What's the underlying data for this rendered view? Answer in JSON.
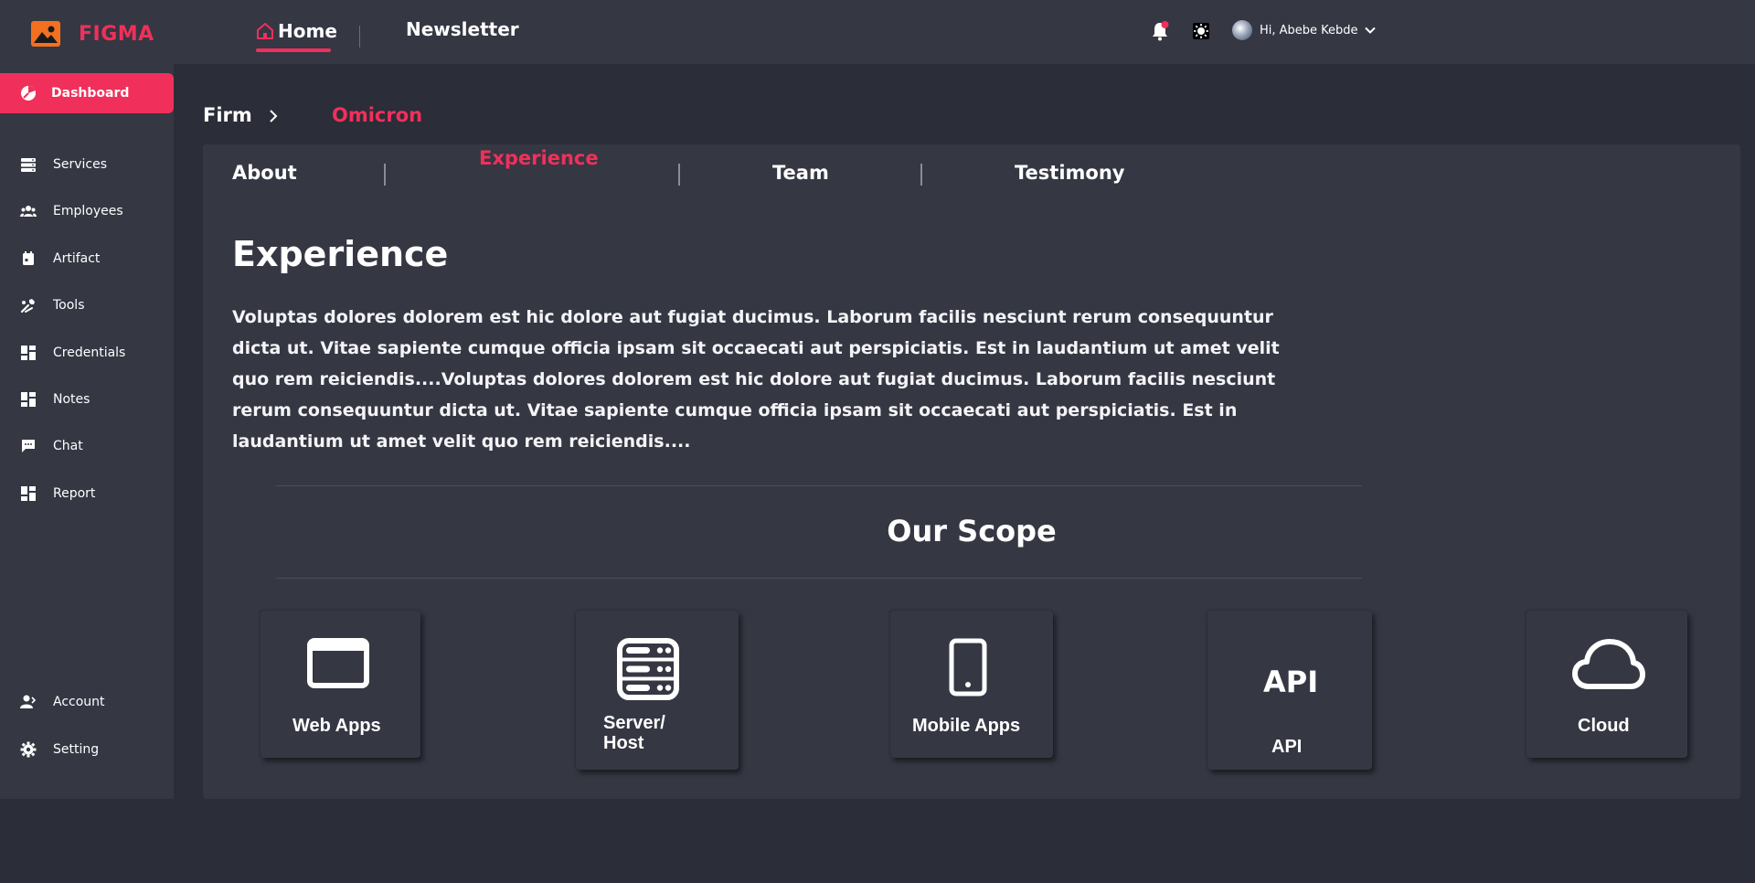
{
  "app": {
    "logo_text": "FIGMA"
  },
  "topnav": {
    "home": "Home",
    "newsletter": "Newsletter"
  },
  "user": {
    "greeting": "Hi, Abebe Kebde"
  },
  "sidebar": {
    "items": [
      {
        "label": "Dashboard",
        "icon": "dashboard-icon"
      },
      {
        "label": "Services",
        "icon": "services-icon"
      },
      {
        "label": "Employees",
        "icon": "employees-icon"
      },
      {
        "label": "Artifact",
        "icon": "artifact-icon"
      },
      {
        "label": "Tools",
        "icon": "tools-icon"
      },
      {
        "label": "Credentials",
        "icon": "grid-icon"
      },
      {
        "label": "Notes",
        "icon": "grid-icon"
      },
      {
        "label": "Chat",
        "icon": "chat-icon"
      },
      {
        "label": "Report",
        "icon": "grid-icon"
      }
    ],
    "bottom": [
      {
        "label": "Account",
        "icon": "account-icon"
      },
      {
        "label": "Setting",
        "icon": "gear-icon"
      }
    ]
  },
  "breadcrumb": {
    "root": "Firm",
    "current": "Omicron"
  },
  "tabs": [
    "About",
    "Experience",
    "Team",
    "Testimony"
  ],
  "content": {
    "title": "Experience",
    "paragraph": "Voluptas dolores dolorem est hic dolore aut fugiat ducimus. Laborum facilis nesciunt rerum consequuntur dicta ut. Vitae sapiente cumque officia ipsam sit occaecati aut perspiciatis. Est in laudantium ut amet velit quo rem reiciendis....Voluptas dolores dolorem est hic dolore aut fugiat ducimus. Laborum facilis nesciunt rerum consequuntur dicta ut. Vitae sapiente cumque officia ipsam sit occaecati aut perspiciatis. Est in laudantium ut amet velit quo rem reiciendis...."
  },
  "scope": {
    "title": "Our Scope",
    "cards": [
      {
        "label": "Web Apps",
        "icon": "browser-window-icon"
      },
      {
        "label": "Server/ Host",
        "icon": "server-icon"
      },
      {
        "label": "Mobile Apps",
        "icon": "mobile-icon"
      },
      {
        "label": "API",
        "icon": "api-icon",
        "icon_text": "API"
      },
      {
        "label": "Cloud",
        "icon": "cloud-icon"
      }
    ]
  },
  "colors": {
    "accent": "#f0305a",
    "background": "#2b2d38",
    "surface": "#353743"
  }
}
